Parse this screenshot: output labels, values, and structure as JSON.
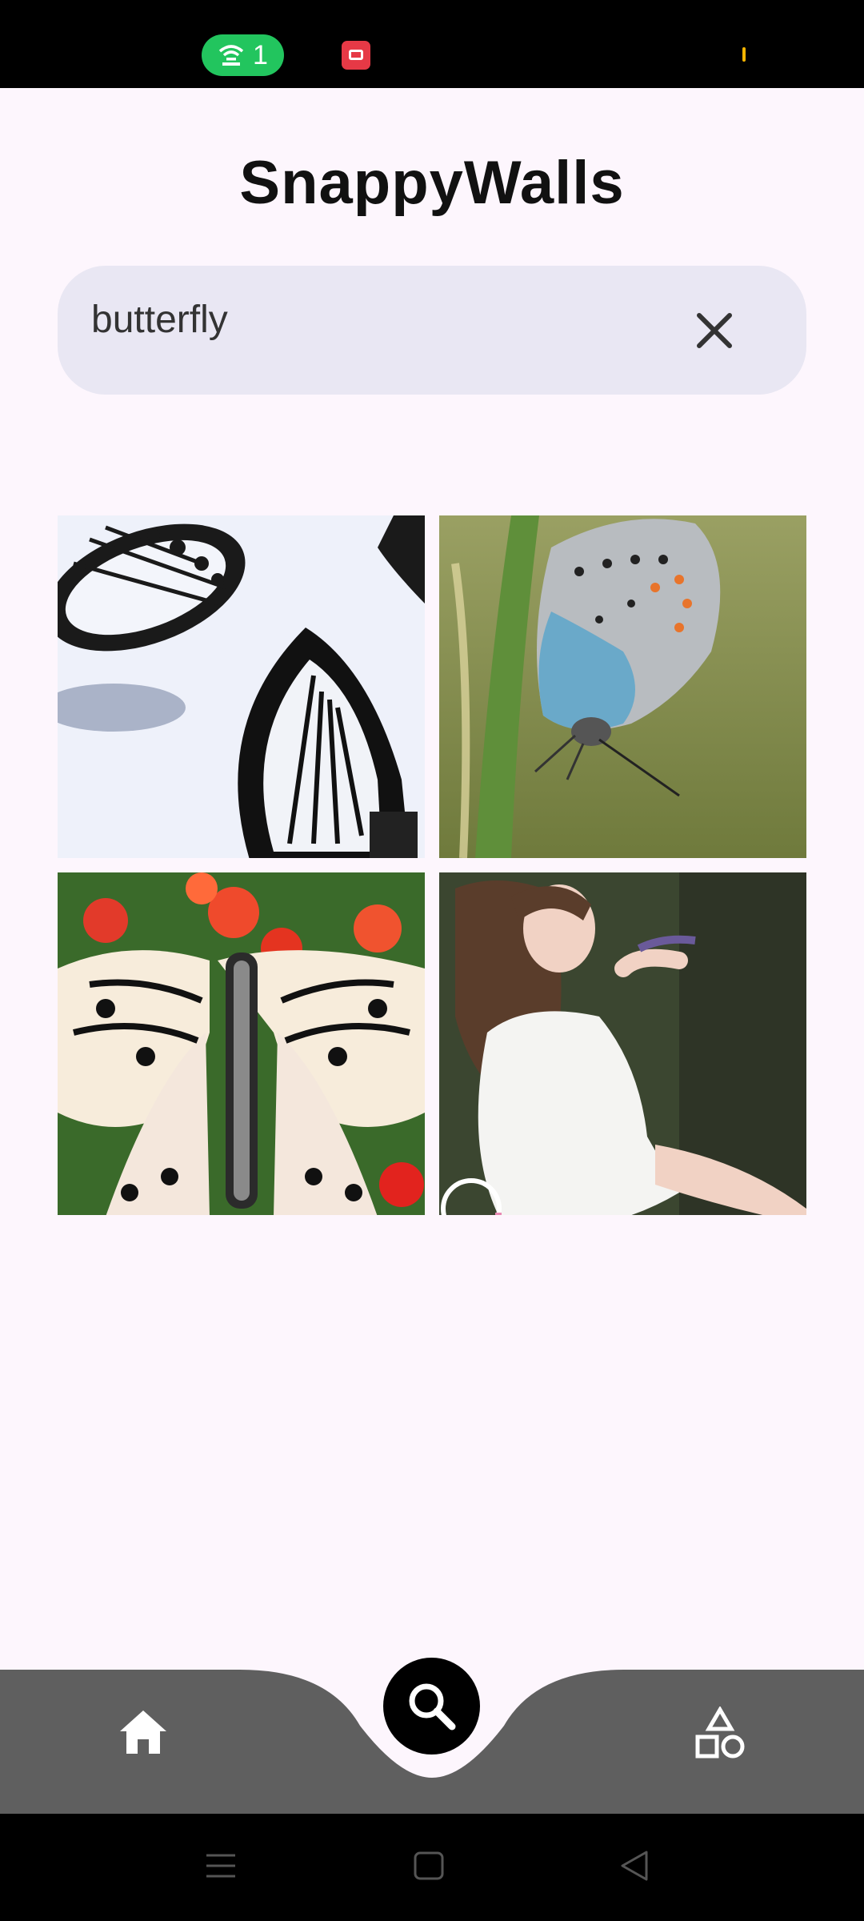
{
  "status_bar": {
    "hotspot_count": "1",
    "icons": [
      "hotspot-icon",
      "screen-record-icon",
      "signal-indicator"
    ]
  },
  "app": {
    "title": "SnappyWalls"
  },
  "search": {
    "value": "butterfly",
    "clear_icon": "close-icon"
  },
  "results": [
    {
      "subject": "black-white-paper-butterflies"
    },
    {
      "subject": "blue-butterfly-on-grass"
    },
    {
      "subject": "paper-kite-butterfly-red-flowers"
    },
    {
      "subject": "girl-in-white-dress-with-butterfly"
    }
  ],
  "bottom_nav": {
    "items": [
      "home-icon",
      "search-icon",
      "categories-icon"
    ],
    "active": "search",
    "colors": {
      "bar": "#5f5f5f",
      "fab": "#000000",
      "icon": "#ffffff"
    }
  },
  "system_nav": [
    "menu-icon",
    "home-square-icon",
    "back-icon"
  ],
  "colors": {
    "background": "#fdf6fd",
    "search_bg": "#e9e7f3",
    "hotspot": "#22c55e",
    "record": "#e63946"
  }
}
